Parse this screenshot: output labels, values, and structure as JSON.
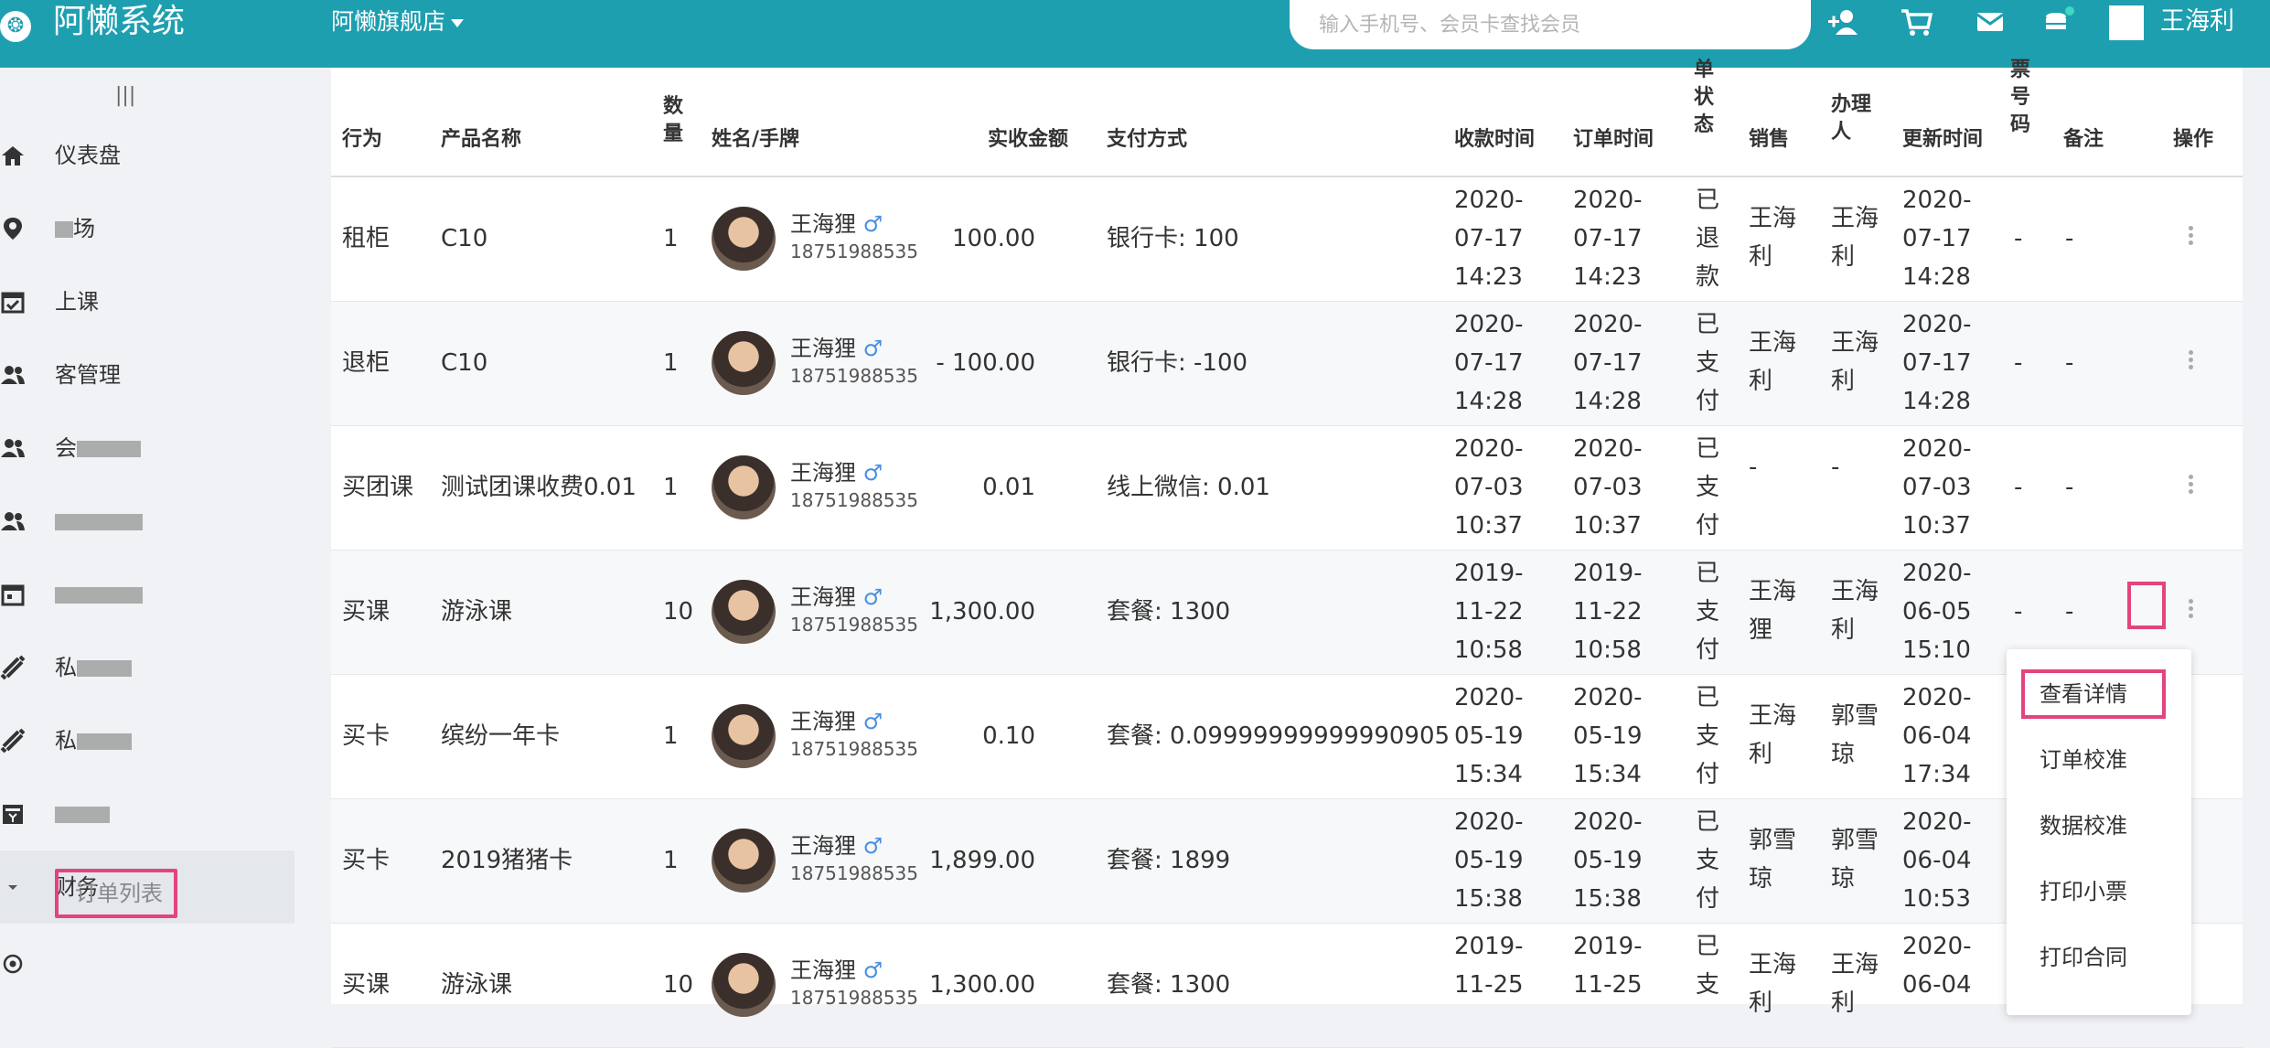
{
  "app": {
    "title": "阿懒系统",
    "store": "阿懒旗舰店"
  },
  "search": {
    "placeholder": "输入手机号、会员卡查找会员"
  },
  "top_icons": [
    "add-user-icon",
    "cart-icon",
    "mail-icon",
    "database-icon"
  ],
  "user": {
    "name": "王海利"
  },
  "sidebar": {
    "collapse_label": "|||",
    "items": [
      {
        "label": "仪表盘",
        "icon": "home-icon"
      },
      {
        "label": "场",
        "icon": "location-icon"
      },
      {
        "label": "上课",
        "icon": "calendar-check-icon"
      },
      {
        "label": "客管理",
        "icon": "users-icon"
      },
      {
        "label": "会",
        "icon": "users-icon"
      },
      {
        "label": "",
        "icon": "users-icon"
      },
      {
        "label": "",
        "icon": "calendar-icon"
      },
      {
        "label": "私",
        "icon": "dumbbell-icon"
      },
      {
        "label": "私",
        "icon": "dumbbell-icon"
      },
      {
        "label": "",
        "icon": "ticket-icon"
      }
    ],
    "finance_label": "财务",
    "active_label": "订单列表"
  },
  "table": {
    "columns": {
      "action": "行为",
      "product": "产品名称",
      "qty": "数量",
      "name": "姓名/手牌",
      "amount": "实收金额",
      "payment": "支付方式",
      "pay_time": "收款时间",
      "order_time": "订单时间",
      "status": "单状态",
      "sales": "销售",
      "handler": "办理人",
      "update_time": "更新时间",
      "ticket_no": "票号码",
      "remark": "备注",
      "operation": "操作"
    },
    "rows": [
      {
        "action": "租柜",
        "product": "C10",
        "qty": "1",
        "name": "王海狸",
        "phone": "18751988535",
        "amount": "100.00",
        "payment": "银行卡: 100",
        "pay_time": [
          "2020-",
          "07-17",
          "14:23"
        ],
        "order_time": [
          "2020-",
          "07-17",
          "14:23"
        ],
        "status": [
          "已",
          "退",
          "款"
        ],
        "sales": [
          "王海",
          "利"
        ],
        "handler": [
          "王海",
          "利"
        ],
        "update_time": [
          "2020-",
          "07-17",
          "14:28"
        ],
        "ticket_no": "-",
        "remark": "-"
      },
      {
        "action": "退柜",
        "product": "C10",
        "qty": "1",
        "name": "王海狸",
        "phone": "18751988535",
        "amount": "- 100.00",
        "payment": "银行卡: -100",
        "pay_time": [
          "2020-",
          "07-17",
          "14:28"
        ],
        "order_time": [
          "2020-",
          "07-17",
          "14:28"
        ],
        "status": [
          "已",
          "支",
          "付"
        ],
        "sales": [
          "王海",
          "利"
        ],
        "handler": [
          "王海",
          "利"
        ],
        "update_time": [
          "2020-",
          "07-17",
          "14:28"
        ],
        "ticket_no": "-",
        "remark": "-"
      },
      {
        "action": "买团课",
        "product": "测试团课收费0.01",
        "qty": "1",
        "name": "王海狸",
        "phone": "18751988535",
        "amount": "0.01",
        "payment": "线上微信: 0.01",
        "pay_time": [
          "2020-",
          "07-03",
          "10:37"
        ],
        "order_time": [
          "2020-",
          "07-03",
          "10:37"
        ],
        "status": [
          "已",
          "支",
          "付"
        ],
        "sales": [
          "-",
          ""
        ],
        "handler": [
          "-",
          ""
        ],
        "update_time": [
          "2020-",
          "07-03",
          "10:37"
        ],
        "ticket_no": "-",
        "remark": "-"
      },
      {
        "action": "买课",
        "product": "游泳课",
        "qty": "10",
        "name": "王海狸",
        "phone": "18751988535",
        "amount": "1,300.00",
        "payment": "套餐: 1300",
        "pay_time": [
          "2019-",
          "11-22",
          "10:58"
        ],
        "order_time": [
          "2019-",
          "11-22",
          "10:58"
        ],
        "status": [
          "已",
          "支",
          "付"
        ],
        "sales": [
          "王海",
          "狸"
        ],
        "handler": [
          "王海",
          "利"
        ],
        "update_time": [
          "2020-",
          "06-05",
          "15:10"
        ],
        "ticket_no": "-",
        "remark": "-"
      },
      {
        "action": "买卡",
        "product": "缤纷一年卡",
        "qty": "1",
        "name": "王海狸",
        "phone": "18751988535",
        "amount": "0.10",
        "payment": "套餐: 0.09999999999990905",
        "pay_time": [
          "2020-",
          "05-19",
          "15:34"
        ],
        "order_time": [
          "2020-",
          "05-19",
          "15:34"
        ],
        "status": [
          "已",
          "支",
          "付"
        ],
        "sales": [
          "王海",
          "利"
        ],
        "handler": [
          "郭雪",
          "琼"
        ],
        "update_time": [
          "2020-",
          "06-04",
          "17:34"
        ],
        "ticket_no": "",
        "remark": ""
      },
      {
        "action": "买卡",
        "product": "2019猪猪卡",
        "qty": "1",
        "name": "王海狸",
        "phone": "18751988535",
        "amount": "1,899.00",
        "payment": "套餐: 1899",
        "pay_time": [
          "2020-",
          "05-19",
          "15:38"
        ],
        "order_time": [
          "2020-",
          "05-19",
          "15:38"
        ],
        "status": [
          "已",
          "支",
          "付"
        ],
        "sales": [
          "郭雪",
          "琼"
        ],
        "handler": [
          "郭雪",
          "琼"
        ],
        "update_time": [
          "2020-",
          "06-04",
          "10:53"
        ],
        "ticket_no": "",
        "remark": ""
      },
      {
        "action": "买课",
        "product": "游泳课",
        "qty": "10",
        "name": "王海狸",
        "phone": "18751988535",
        "amount": "1,300.00",
        "payment": "套餐: 1300",
        "pay_time": [
          "2019-",
          "11-25",
          ""
        ],
        "order_time": [
          "2019-",
          "11-25",
          ""
        ],
        "status": [
          "已",
          "支",
          ""
        ],
        "sales": [
          "王海",
          "利"
        ],
        "handler": [
          "王海",
          "利"
        ],
        "update_time": [
          "2020-",
          "06-04",
          ""
        ],
        "ticket_no": "",
        "remark": ""
      }
    ]
  },
  "context_menu": {
    "items": [
      "查看详情",
      "订单校准",
      "数据校准",
      "打印小票",
      "打印合同"
    ]
  }
}
